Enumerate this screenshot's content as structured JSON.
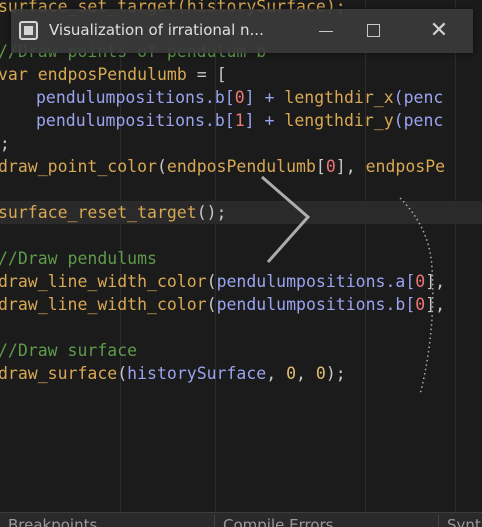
{
  "window": {
    "title": "Visualization of irrational n..."
  },
  "code": {
    "l0": "surface_set_target(historySurface);",
    "comment_b": "//Draw points of pendulum b",
    "l_var_kw": "var",
    "l_var_name": "endposPendulumb",
    "l_var_rest": " = [",
    "l3_a": "pendulumpositions",
    "l3_b": ".b[",
    "l3_idx": "0",
    "l3_c": "] + ",
    "l3_fn": "lengthdir_x",
    "l3_d": "(penc",
    "l4_a": "pendulumpositions",
    "l4_b": ".b[",
    "l4_idx": "1",
    "l4_c": "] + ",
    "l4_fn": "lengthdir_y",
    "l4_d": "(penc",
    "l5": "];",
    "l6_fn": "draw_point_color",
    "l6_a": "(",
    "l6_var": "endposPendulumb",
    "l6_b": "[",
    "l6_idx": "0",
    "l6_c": "], ",
    "l6_var2": "endposPe",
    "l8_fn": "surface_reset_target",
    "l8_rest": "();",
    "comment_p": "//Draw pendulums",
    "l11_fn": "draw_line_width_color",
    "l11_a": "(",
    "l11_var": "pendulumpositions",
    "l11_b": ".a[",
    "l11_idx": "0",
    "l11_c": "],",
    "l12_fn": "draw_line_width_color",
    "l12_a": "(",
    "l12_var": "pendulumpositions",
    "l12_b": ".b[",
    "l12_idx": "0",
    "l12_c": "],",
    "comment_s": "//Draw surface",
    "l15_fn": "draw_surface",
    "l15_a": "(",
    "l15_var": "historySurface",
    "l15_b": ", ",
    "l15_n1": "0",
    "l15_c": ", ",
    "l15_n2": "0",
    "l15_d": ");"
  },
  "bottom_tabs": [
    "Breakpoints",
    "Compile Errors",
    "Synt"
  ]
}
